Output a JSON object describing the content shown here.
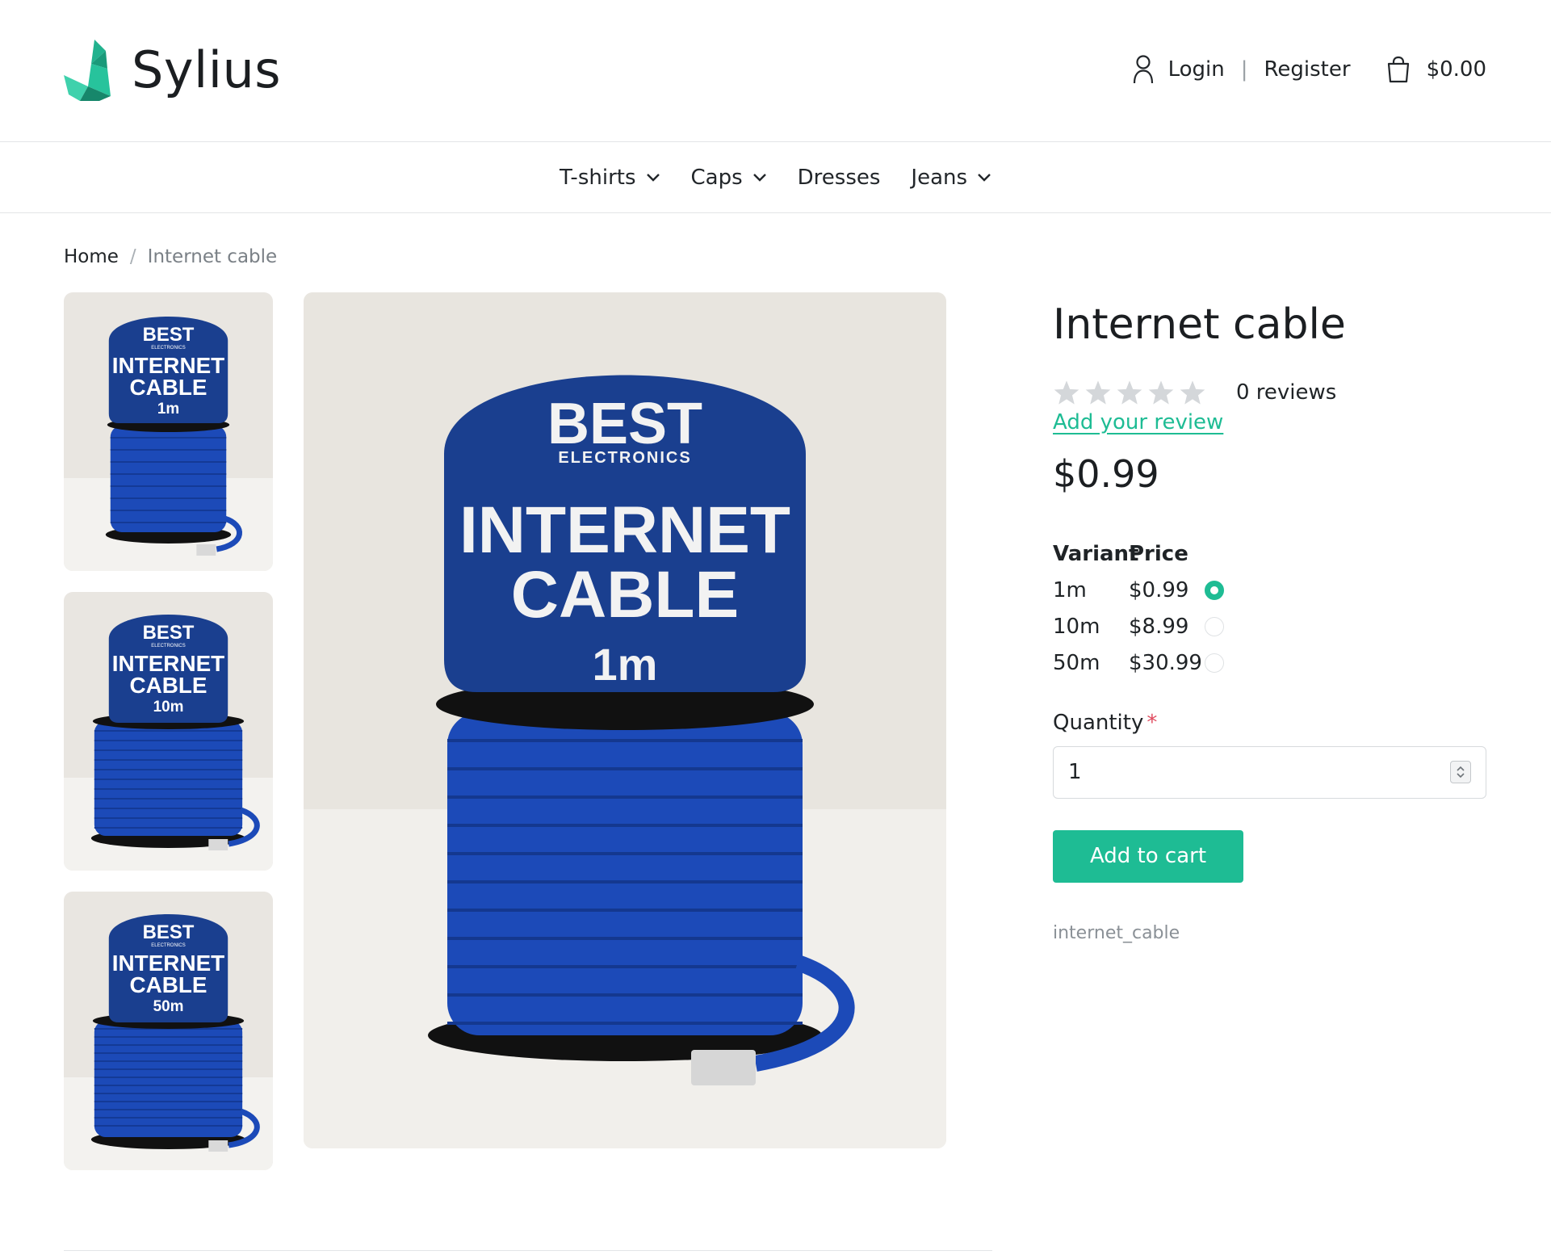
{
  "header": {
    "logo_text": "Sylius",
    "login_label": "Login",
    "separator": "|",
    "register_label": "Register",
    "cart_total": "$0.00",
    "brand_color": "#1ebc94"
  },
  "nav": {
    "items": [
      {
        "label": "T-shirts",
        "has_dropdown": true
      },
      {
        "label": "Caps",
        "has_dropdown": true
      },
      {
        "label": "Dresses",
        "has_dropdown": false
      },
      {
        "label": "Jeans",
        "has_dropdown": true
      }
    ]
  },
  "breadcrumb": {
    "home": "Home",
    "separator": "/",
    "current": "Internet cable"
  },
  "gallery": {
    "main": {
      "brand": "BEST",
      "sub": "ELECTRONICS",
      "line1": "INTERNET",
      "line2": "CABLE",
      "length": "1m"
    },
    "thumbnails": [
      {
        "brand": "BEST",
        "sub": "ELECTRONICS",
        "line1": "INTERNET",
        "line2": "CABLE",
        "length": "1m"
      },
      {
        "brand": "BEST",
        "sub": "ELECTRONICS",
        "line1": "INTERNET",
        "line2": "CABLE",
        "length": "10m"
      },
      {
        "brand": "BEST",
        "sub": "ELECTRONICS",
        "line1": "INTERNET",
        "line2": "CABLE",
        "length": "50m"
      }
    ]
  },
  "product": {
    "title": "Internet cable",
    "rating": 0,
    "max_rating": 5,
    "review_count": "0 reviews",
    "add_review": "Add your review",
    "price": "$0.99",
    "variant_header": "Variant",
    "price_header": "Price",
    "variants": [
      {
        "name": "1m",
        "price": "$0.99",
        "selected": true
      },
      {
        "name": "10m",
        "price": "$8.99",
        "selected": false
      },
      {
        "name": "50m",
        "price": "$30.99",
        "selected": false
      }
    ],
    "quantity_label": "Quantity",
    "required_mark": "*",
    "quantity_value": "1",
    "add_to_cart": "Add to cart",
    "code": "internet_cable"
  }
}
